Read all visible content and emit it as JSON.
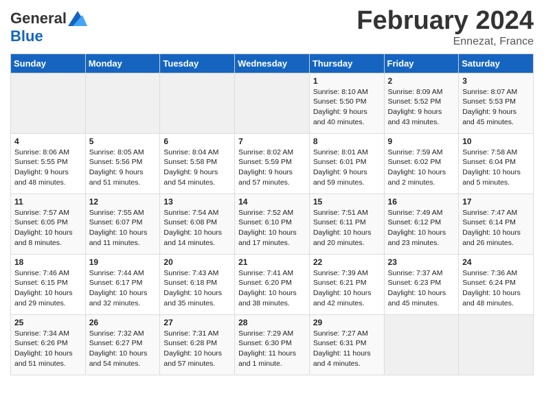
{
  "header": {
    "logo_general": "General",
    "logo_blue": "Blue",
    "month_title": "February 2024",
    "subtitle": "Ennezat, France"
  },
  "days_of_week": [
    "Sunday",
    "Monday",
    "Tuesday",
    "Wednesday",
    "Thursday",
    "Friday",
    "Saturday"
  ],
  "weeks": [
    [
      {
        "day": "",
        "info": ""
      },
      {
        "day": "",
        "info": ""
      },
      {
        "day": "",
        "info": ""
      },
      {
        "day": "",
        "info": ""
      },
      {
        "day": "1",
        "info": "Sunrise: 8:10 AM\nSunset: 5:50 PM\nDaylight: 9 hours\nand 40 minutes."
      },
      {
        "day": "2",
        "info": "Sunrise: 8:09 AM\nSunset: 5:52 PM\nDaylight: 9 hours\nand 43 minutes."
      },
      {
        "day": "3",
        "info": "Sunrise: 8:07 AM\nSunset: 5:53 PM\nDaylight: 9 hours\nand 45 minutes."
      }
    ],
    [
      {
        "day": "4",
        "info": "Sunrise: 8:06 AM\nSunset: 5:55 PM\nDaylight: 9 hours\nand 48 minutes."
      },
      {
        "day": "5",
        "info": "Sunrise: 8:05 AM\nSunset: 5:56 PM\nDaylight: 9 hours\nand 51 minutes."
      },
      {
        "day": "6",
        "info": "Sunrise: 8:04 AM\nSunset: 5:58 PM\nDaylight: 9 hours\nand 54 minutes."
      },
      {
        "day": "7",
        "info": "Sunrise: 8:02 AM\nSunset: 5:59 PM\nDaylight: 9 hours\nand 57 minutes."
      },
      {
        "day": "8",
        "info": "Sunrise: 8:01 AM\nSunset: 6:01 PM\nDaylight: 9 hours\nand 59 minutes."
      },
      {
        "day": "9",
        "info": "Sunrise: 7:59 AM\nSunset: 6:02 PM\nDaylight: 10 hours\nand 2 minutes."
      },
      {
        "day": "10",
        "info": "Sunrise: 7:58 AM\nSunset: 6:04 PM\nDaylight: 10 hours\nand 5 minutes."
      }
    ],
    [
      {
        "day": "11",
        "info": "Sunrise: 7:57 AM\nSunset: 6:05 PM\nDaylight: 10 hours\nand 8 minutes."
      },
      {
        "day": "12",
        "info": "Sunrise: 7:55 AM\nSunset: 6:07 PM\nDaylight: 10 hours\nand 11 minutes."
      },
      {
        "day": "13",
        "info": "Sunrise: 7:54 AM\nSunset: 6:08 PM\nDaylight: 10 hours\nand 14 minutes."
      },
      {
        "day": "14",
        "info": "Sunrise: 7:52 AM\nSunset: 6:10 PM\nDaylight: 10 hours\nand 17 minutes."
      },
      {
        "day": "15",
        "info": "Sunrise: 7:51 AM\nSunset: 6:11 PM\nDaylight: 10 hours\nand 20 minutes."
      },
      {
        "day": "16",
        "info": "Sunrise: 7:49 AM\nSunset: 6:12 PM\nDaylight: 10 hours\nand 23 minutes."
      },
      {
        "day": "17",
        "info": "Sunrise: 7:47 AM\nSunset: 6:14 PM\nDaylight: 10 hours\nand 26 minutes."
      }
    ],
    [
      {
        "day": "18",
        "info": "Sunrise: 7:46 AM\nSunset: 6:15 PM\nDaylight: 10 hours\nand 29 minutes."
      },
      {
        "day": "19",
        "info": "Sunrise: 7:44 AM\nSunset: 6:17 PM\nDaylight: 10 hours\nand 32 minutes."
      },
      {
        "day": "20",
        "info": "Sunrise: 7:43 AM\nSunset: 6:18 PM\nDaylight: 10 hours\nand 35 minutes."
      },
      {
        "day": "21",
        "info": "Sunrise: 7:41 AM\nSunset: 6:20 PM\nDaylight: 10 hours\nand 38 minutes."
      },
      {
        "day": "22",
        "info": "Sunrise: 7:39 AM\nSunset: 6:21 PM\nDaylight: 10 hours\nand 42 minutes."
      },
      {
        "day": "23",
        "info": "Sunrise: 7:37 AM\nSunset: 6:23 PM\nDaylight: 10 hours\nand 45 minutes."
      },
      {
        "day": "24",
        "info": "Sunrise: 7:36 AM\nSunset: 6:24 PM\nDaylight: 10 hours\nand 48 minutes."
      }
    ],
    [
      {
        "day": "25",
        "info": "Sunrise: 7:34 AM\nSunset: 6:26 PM\nDaylight: 10 hours\nand 51 minutes."
      },
      {
        "day": "26",
        "info": "Sunrise: 7:32 AM\nSunset: 6:27 PM\nDaylight: 10 hours\nand 54 minutes."
      },
      {
        "day": "27",
        "info": "Sunrise: 7:31 AM\nSunset: 6:28 PM\nDaylight: 10 hours\nand 57 minutes."
      },
      {
        "day": "28",
        "info": "Sunrise: 7:29 AM\nSunset: 6:30 PM\nDaylight: 11 hours\nand 1 minute."
      },
      {
        "day": "29",
        "info": "Sunrise: 7:27 AM\nSunset: 6:31 PM\nDaylight: 11 hours\nand 4 minutes."
      },
      {
        "day": "",
        "info": ""
      },
      {
        "day": "",
        "info": ""
      }
    ]
  ]
}
